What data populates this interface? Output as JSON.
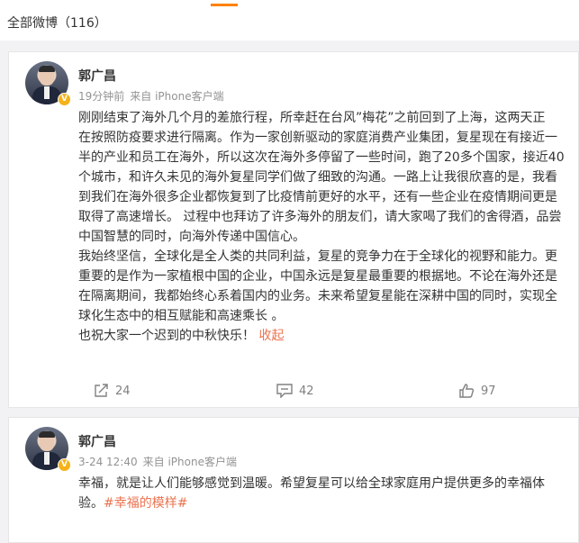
{
  "feed": {
    "count_label": "全部微博（116）"
  },
  "posts": [
    {
      "author": "郭广昌",
      "time": "19分钟前",
      "source": "来自 iPhone客户端",
      "paragraphs": [
        "刚刚结束了海外几个月的差旅行程，所幸赶在台风”梅花”之前回到了上海，这两天正",
        "在按照防疫要求进行隔离。作为一家创新驱动的家庭消费产业集团，复星现在有接近一",
        "半的产业和员工在海外，所以这次在海外多停留了一些时间，跑了20多个国家，接近40",
        "个城市，和许久未见的海外复星同学们做了细致的沟通。一路上让我很欣喜的是，我看",
        "到我们在海外很多企业都恢复到了比疫情前更好的水平，还有一些企业在疫情期间更是",
        "取得了高速增长。 过程中也拜访了许多海外的朋友们，请大家喝了我们的舍得酒，品尝",
        "中国智慧的同时，向海外传递中国信心。",
        "我始终坚信，全球化是全人类的共同利益，复星的竞争力在于全球化的视野和能力。更",
        "重要的是作为一家植根中国的企业，中国永远是复星最重要的根据地。不论在海外还是",
        "在隔离期间，我都始终心系着国内的业务。未来希望复星能在深耕中国的同时，实现全",
        "球化生态中的相互赋能和高速乘长 。"
      ],
      "last_line": "也祝大家一个迟到的中秋快乐！",
      "collapse_label": "收起",
      "reposts": "24",
      "comments": "42",
      "likes": "97"
    },
    {
      "author": "郭广昌",
      "time": "3-24 12:40",
      "source": "来自 iPhone客户端",
      "line1": "幸福，就是让人们能够感觉到温暖。希望复星可以给全球家庭用户提供更多的幸福体",
      "line2_prefix": "验。",
      "hashtag": "#幸福的模样#"
    }
  ],
  "colors": {
    "accent": "#ff8200",
    "link": "#eb7350",
    "badge": "#f6b21a"
  }
}
